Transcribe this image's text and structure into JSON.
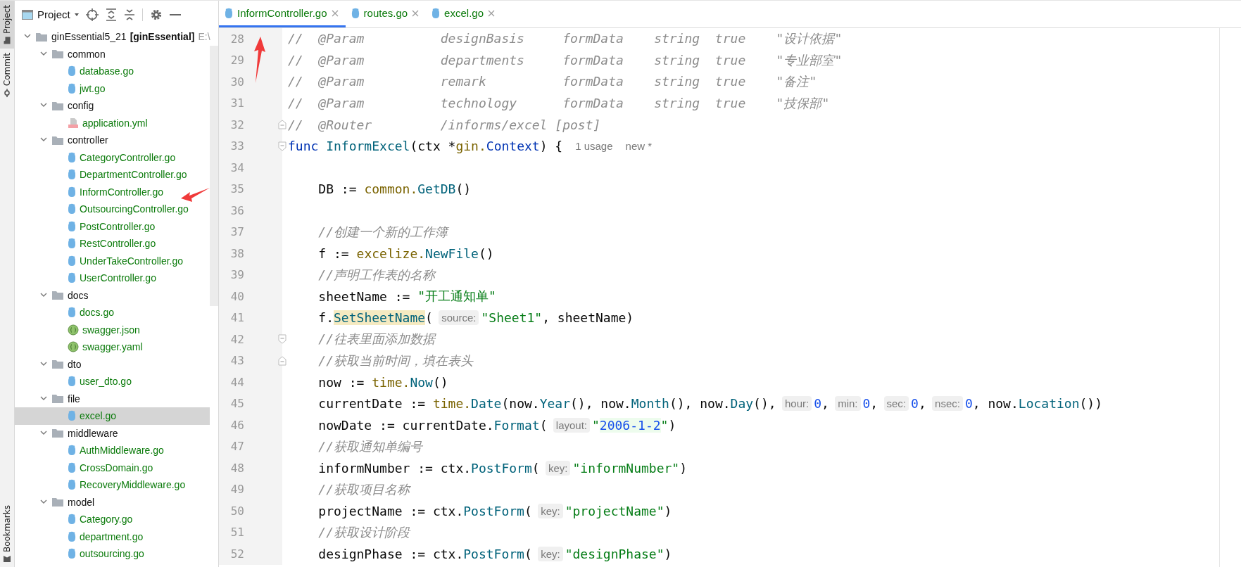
{
  "tool_strip": {
    "top": [
      {
        "label": "Project",
        "kind": "folder",
        "selected": true
      },
      {
        "label": "Commit",
        "kind": "commit",
        "selected": false
      }
    ],
    "bottom": [
      {
        "label": "Bookmarks",
        "kind": "bookmark",
        "selected": false
      }
    ]
  },
  "project_panel": {
    "title": "Project",
    "tree": [
      {
        "label": "ginEssential5_21",
        "module": "[ginEssential]",
        "path": "E:\\",
        "kind": "folder",
        "expanded": true,
        "selected": false,
        "children": [
          {
            "label": "common",
            "kind": "folder",
            "expanded": true,
            "selected": false,
            "children": [
              {
                "label": "database.go",
                "kind": "go",
                "selected": false
              },
              {
                "label": "jwt.go",
                "kind": "go",
                "selected": false
              }
            ]
          },
          {
            "label": "config",
            "kind": "folder",
            "expanded": true,
            "selected": false,
            "children": [
              {
                "label": "application.yml",
                "kind": "yml",
                "selected": false
              }
            ]
          },
          {
            "label": "controller",
            "kind": "folder",
            "expanded": true,
            "selected": false,
            "children": [
              {
                "label": "CategoryController.go",
                "kind": "go",
                "selected": false
              },
              {
                "label": "DepartmentController.go",
                "kind": "go",
                "selected": false
              },
              {
                "label": "InformController.go",
                "kind": "go",
                "selected": false
              },
              {
                "label": "OutsourcingController.go",
                "kind": "go",
                "selected": false
              },
              {
                "label": "PostController.go",
                "kind": "go",
                "selected": false
              },
              {
                "label": "RestController.go",
                "kind": "go",
                "selected": false
              },
              {
                "label": "UnderTakeController.go",
                "kind": "go",
                "selected": false
              },
              {
                "label": "UserController.go",
                "kind": "go",
                "selected": false
              }
            ]
          },
          {
            "label": "docs",
            "kind": "folder",
            "expanded": true,
            "selected": false,
            "children": [
              {
                "label": "docs.go",
                "kind": "go",
                "selected": false
              },
              {
                "label": "swagger.json",
                "kind": "swagger",
                "selected": false
              },
              {
                "label": "swagger.yaml",
                "kind": "swagger",
                "selected": false
              }
            ]
          },
          {
            "label": "dto",
            "kind": "folder",
            "expanded": true,
            "selected": false,
            "children": [
              {
                "label": "user_dto.go",
                "kind": "go",
                "selected": false
              }
            ]
          },
          {
            "label": "file",
            "kind": "folder",
            "expanded": true,
            "selected": false,
            "children": [
              {
                "label": "excel.go",
                "kind": "go",
                "selected": true
              }
            ]
          },
          {
            "label": "middleware",
            "kind": "folder",
            "expanded": true,
            "selected": false,
            "children": [
              {
                "label": "AuthMiddleware.go",
                "kind": "go",
                "selected": false
              },
              {
                "label": "CrossDomain.go",
                "kind": "go",
                "selected": false
              },
              {
                "label": "RecoveryMiddleware.go",
                "kind": "go",
                "selected": false
              }
            ]
          },
          {
            "label": "model",
            "kind": "folder",
            "expanded": true,
            "selected": false,
            "children": [
              {
                "label": "Category.go",
                "kind": "go",
                "selected": false
              },
              {
                "label": "department.go",
                "kind": "go",
                "selected": false
              },
              {
                "label": "outsourcing.go",
                "kind": "go",
                "selected": false
              }
            ]
          }
        ]
      }
    ]
  },
  "tabs": [
    {
      "label": "InformController.go",
      "selected": true
    },
    {
      "label": "routes.go",
      "selected": false
    },
    {
      "label": "excel.go",
      "selected": false
    }
  ],
  "editor": {
    "lines": [
      {
        "number": "28",
        "segments": [
          {
            "t": "//  @Param          designBasis     formData    string  true    \"设计依据\"",
            "kind": "cmt"
          }
        ]
      },
      {
        "number": "29",
        "segments": [
          {
            "t": "//  @Param          departments     formData    string  true    \"专业部室\"",
            "kind": "cmt"
          }
        ]
      },
      {
        "number": "30",
        "segments": [
          {
            "t": "//  @Param          remark          formData    string  true    \"备注\"",
            "kind": "cmt"
          }
        ]
      },
      {
        "number": "31",
        "segments": [
          {
            "t": "//  @Param          technology      formData    string  true    \"技保部\"",
            "kind": "cmt"
          }
        ]
      },
      {
        "number": "32",
        "fold_marker": {
          "kind": "end"
        },
        "segments": [
          {
            "t": "//  @Router         /informs/excel [post]",
            "kind": "cmt"
          }
        ]
      },
      {
        "number": "33",
        "fold_marker": {
          "kind": "start"
        },
        "segments": [
          {
            "t": "func",
            "kind": "kw"
          },
          {
            "t": "InformExcel",
            "kind": "fn"
          },
          {
            "t": "(ctx *",
            "kind": "plain"
          },
          {
            "t": "gin.",
            "kind": "pkg"
          },
          {
            "t": "Context",
            "kind": "type"
          },
          {
            "t": ") {",
            "kind": "plain"
          },
          {
            "t": "1 usage",
            "kind": "usage"
          },
          {
            "t": "new *",
            "kind": "usage"
          }
        ]
      },
      {
        "number": "34"
      },
      {
        "number": "35",
        "segments": [
          {
            "t": "    DB := ",
            "kind": "plain"
          },
          {
            "t": "common.",
            "kind": "pkg"
          },
          {
            "t": "GetDB",
            "kind": "method"
          },
          {
            "t": "()",
            "kind": "plain"
          }
        ]
      },
      {
        "number": "36"
      },
      {
        "number": "37",
        "segments": [
          {
            "t": "    //创建一个新的工作簿",
            "kind": "cmt"
          }
        ]
      },
      {
        "number": "38",
        "segments": [
          {
            "t": "    f := ",
            "kind": "plain"
          },
          {
            "t": "excelize.",
            "kind": "pkg"
          },
          {
            "t": "NewFile",
            "kind": "method"
          },
          {
            "t": "()",
            "kind": "plain"
          }
        ]
      },
      {
        "number": "39",
        "segments": [
          {
            "t": "    //声明工作表的名称",
            "kind": "cmt"
          }
        ]
      },
      {
        "number": "40",
        "segments": [
          {
            "t": "    sheetName := ",
            "kind": "plain"
          },
          {
            "t": "\"开工通知单\"",
            "kind": "str"
          }
        ]
      },
      {
        "number": "41",
        "segments": [
          {
            "t": "    f.",
            "kind": "plain"
          },
          {
            "t": "SetSheetName",
            "kind": "hl"
          },
          {
            "t": "(",
            "kind": "plain"
          },
          {
            "t": "source:",
            "kind": "hint"
          },
          {
            "t": "\"Sheet1\"",
            "kind": "str"
          },
          {
            "t": ", sheetName)",
            "kind": "plain"
          }
        ]
      },
      {
        "number": "42",
        "fold_marker": {
          "kind": "start"
        },
        "segments": [
          {
            "t": "    //往表里面添加数据",
            "kind": "cmt"
          }
        ]
      },
      {
        "number": "43",
        "fold_marker": {
          "kind": "end"
        },
        "segments": [
          {
            "t": "    //获取当前时间，填在表头",
            "kind": "cmt"
          }
        ]
      },
      {
        "number": "44",
        "segments": [
          {
            "t": "    now := ",
            "kind": "plain"
          },
          {
            "t": "time.",
            "kind": "pkg"
          },
          {
            "t": "Now",
            "kind": "method"
          },
          {
            "t": "()",
            "kind": "plain"
          }
        ]
      },
      {
        "number": "45",
        "segments": [
          {
            "t": "    currentDate := ",
            "kind": "plain"
          },
          {
            "t": "time.",
            "kind": "pkg"
          },
          {
            "t": "Date",
            "kind": "method"
          },
          {
            "t": "(now.",
            "kind": "plain"
          },
          {
            "t": "Year",
            "kind": "method"
          },
          {
            "t": "(), now.",
            "kind": "plain"
          },
          {
            "t": "Month",
            "kind": "method"
          },
          {
            "t": "(), now.",
            "kind": "plain"
          },
          {
            "t": "Day",
            "kind": "method"
          },
          {
            "t": "(),",
            "kind": "plain"
          },
          {
            "t": "hour:",
            "kind": "hint"
          },
          {
            "t": "0",
            "kind": "num"
          },
          {
            "t": ",",
            "kind": "plain"
          },
          {
            "t": "min:",
            "kind": "hint"
          },
          {
            "t": "0",
            "kind": "num"
          },
          {
            "t": ",",
            "kind": "plain"
          },
          {
            "t": "sec:",
            "kind": "hint"
          },
          {
            "t": "0",
            "kind": "num"
          },
          {
            "t": ",",
            "kind": "plain"
          },
          {
            "t": "nsec:",
            "kind": "hint"
          },
          {
            "t": "0",
            "kind": "num"
          },
          {
            "t": ", now.",
            "kind": "plain"
          },
          {
            "t": "Location",
            "kind": "method"
          },
          {
            "t": "())",
            "kind": "plain"
          }
        ]
      },
      {
        "number": "46",
        "segments": [
          {
            "t": "    nowDate := currentDate.",
            "kind": "plain"
          },
          {
            "t": "Format",
            "kind": "method"
          },
          {
            "t": "(",
            "kind": "plain"
          },
          {
            "t": "layout:",
            "kind": "hint"
          },
          {
            "t": "\"",
            "kind": "str"
          },
          {
            "t": "2006-1-2",
            "kind": "fmt"
          },
          {
            "t": "\"",
            "kind": "str"
          },
          {
            "t": ")",
            "kind": "plain"
          }
        ]
      },
      {
        "number": "47",
        "segments": [
          {
            "t": "    //获取通知单编号",
            "kind": "cmt"
          }
        ]
      },
      {
        "number": "48",
        "segments": [
          {
            "t": "    informNumber := ctx.",
            "kind": "plain"
          },
          {
            "t": "PostForm",
            "kind": "method"
          },
          {
            "t": "(",
            "kind": "plain"
          },
          {
            "t": "key:",
            "kind": "hint"
          },
          {
            "t": "\"informNumber\"",
            "kind": "str"
          },
          {
            "t": ")",
            "kind": "plain"
          }
        ]
      },
      {
        "number": "49",
        "segments": [
          {
            "t": "    //获取项目名称",
            "kind": "cmt"
          }
        ]
      },
      {
        "number": "50",
        "segments": [
          {
            "t": "    projectName := ctx.",
            "kind": "plain"
          },
          {
            "t": "PostForm",
            "kind": "method"
          },
          {
            "t": "(",
            "kind": "plain"
          },
          {
            "t": "key:",
            "kind": "hint"
          },
          {
            "t": "\"projectName\"",
            "kind": "str"
          },
          {
            "t": ")",
            "kind": "plain"
          }
        ]
      },
      {
        "number": "51",
        "segments": [
          {
            "t": "    //获取设计阶段",
            "kind": "cmt"
          }
        ]
      },
      {
        "number": "52",
        "segments": [
          {
            "t": "    designPhase := ctx.",
            "kind": "plain"
          },
          {
            "t": "PostForm",
            "kind": "method"
          },
          {
            "t": "(",
            "kind": "plain"
          },
          {
            "t": "key:",
            "kind": "hint"
          },
          {
            "t": "\"designPhase\"",
            "kind": "str"
          },
          {
            "t": ")",
            "kind": "plain"
          }
        ]
      }
    ]
  }
}
